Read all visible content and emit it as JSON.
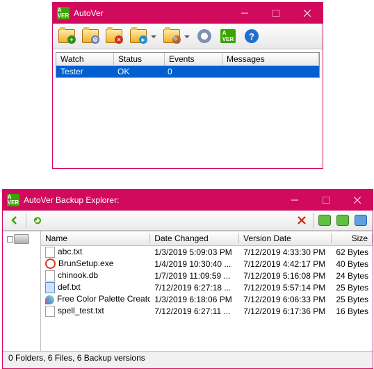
{
  "win1": {
    "title": "AutoVer",
    "grid": {
      "headers": [
        "Watch",
        "Status",
        "Events",
        "Messages"
      ],
      "rows": [
        {
          "watch": "Tester",
          "status": "OK",
          "events": "0",
          "messages": ""
        }
      ]
    }
  },
  "win2": {
    "title": "AutoVer Backup Explorer:",
    "columns": [
      "Name",
      "Date Changed",
      "Version Date",
      "Size"
    ],
    "files": [
      {
        "icon": "txt",
        "name": "abc.txt",
        "date": "1/3/2019 5:09:03 PM",
        "ver": "7/12/2019 4:33:30 PM",
        "size": "62 Bytes"
      },
      {
        "icon": "exe",
        "name": "BrunSetup.exe",
        "date": "1/4/2019 10:30:40 ...",
        "ver": "7/12/2019 4:42:17 PM",
        "size": "40 Bytes"
      },
      {
        "icon": "db",
        "name": "chinook.db",
        "date": "1/7/2019 11:09:59 ...",
        "ver": "7/12/2019 5:16:08 PM",
        "size": "24 Bytes"
      },
      {
        "icon": "blue",
        "name": "def.txt",
        "date": "7/12/2019 6:27:18 ...",
        "ver": "7/12/2019 5:57:14 PM",
        "size": "25 Bytes"
      },
      {
        "icon": "palette",
        "name": "Free Color Palette Creator ..",
        "date": "1/3/2019 6:18:06 PM",
        "ver": "7/12/2019 6:06:33 PM",
        "size": "25 Bytes"
      },
      {
        "icon": "txt",
        "name": "spell_test.txt",
        "date": "7/12/2019 6:27:11 ...",
        "ver": "7/12/2019 6:17:36 PM",
        "size": "16 Bytes"
      }
    ],
    "status": "0 Folders, 6 Files, 6 Backup versions"
  }
}
